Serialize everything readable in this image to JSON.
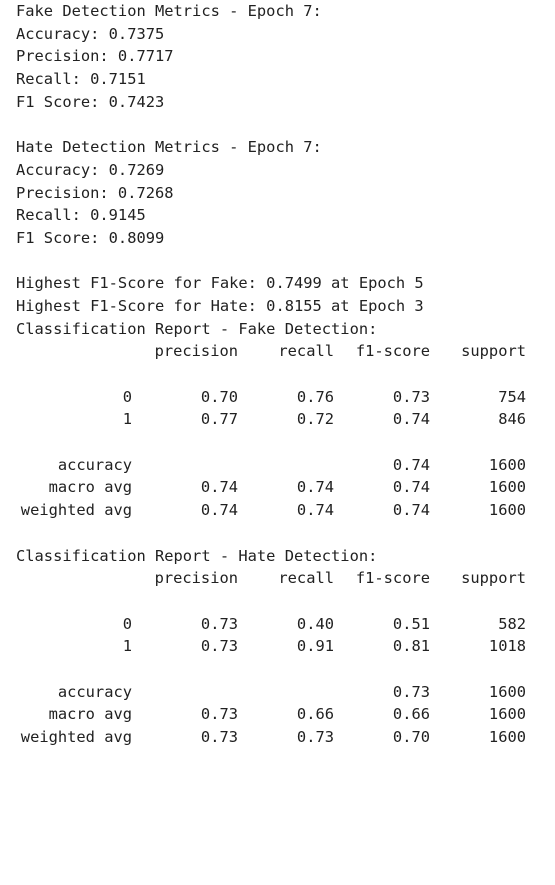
{
  "fake_metrics": {
    "title": "Fake Detection Metrics - Epoch 7:",
    "accuracy": "Accuracy: 0.7375",
    "precision": "Precision: 0.7717",
    "recall": "Recall: 0.7151",
    "f1": "F1 Score: 0.7423"
  },
  "hate_metrics": {
    "title": "Hate Detection Metrics - Epoch 7:",
    "accuracy": "Accuracy: 0.7269",
    "precision": "Precision: 0.7268",
    "recall": "Recall: 0.9145",
    "f1": "F1 Score: 0.8099"
  },
  "highest": {
    "fake": "Highest F1-Score for Fake: 0.7499 at Epoch 5",
    "hate": "Highest F1-Score for Hate: 0.8155 at Epoch 3"
  },
  "report_headers": {
    "precision": "precision",
    "recall": "recall",
    "f1": "f1-score",
    "support": "support"
  },
  "fake_report": {
    "title": "Classification Report - Fake Detection:",
    "classes": [
      {
        "label": "0",
        "precision": "0.70",
        "recall": "0.76",
        "f1": "0.73",
        "support": "754"
      },
      {
        "label": "1",
        "precision": "0.77",
        "recall": "0.72",
        "f1": "0.74",
        "support": "846"
      }
    ],
    "accuracy": {
      "label": "accuracy",
      "f1": "0.74",
      "support": "1600"
    },
    "macro": {
      "label": "macro avg",
      "precision": "0.74",
      "recall": "0.74",
      "f1": "0.74",
      "support": "1600"
    },
    "weighted": {
      "label": "weighted avg",
      "precision": "0.74",
      "recall": "0.74",
      "f1": "0.74",
      "support": "1600"
    }
  },
  "hate_report": {
    "title": "Classification Report - Hate Detection:",
    "classes": [
      {
        "label": "0",
        "precision": "0.73",
        "recall": "0.40",
        "f1": "0.51",
        "support": "582"
      },
      {
        "label": "1",
        "precision": "0.73",
        "recall": "0.91",
        "f1": "0.81",
        "support": "1018"
      }
    ],
    "accuracy": {
      "label": "accuracy",
      "f1": "0.73",
      "support": "1600"
    },
    "macro": {
      "label": "macro avg",
      "precision": "0.73",
      "recall": "0.66",
      "f1": "0.66",
      "support": "1600"
    },
    "weighted": {
      "label": "weighted avg",
      "precision": "0.73",
      "recall": "0.73",
      "f1": "0.70",
      "support": "1600"
    }
  }
}
